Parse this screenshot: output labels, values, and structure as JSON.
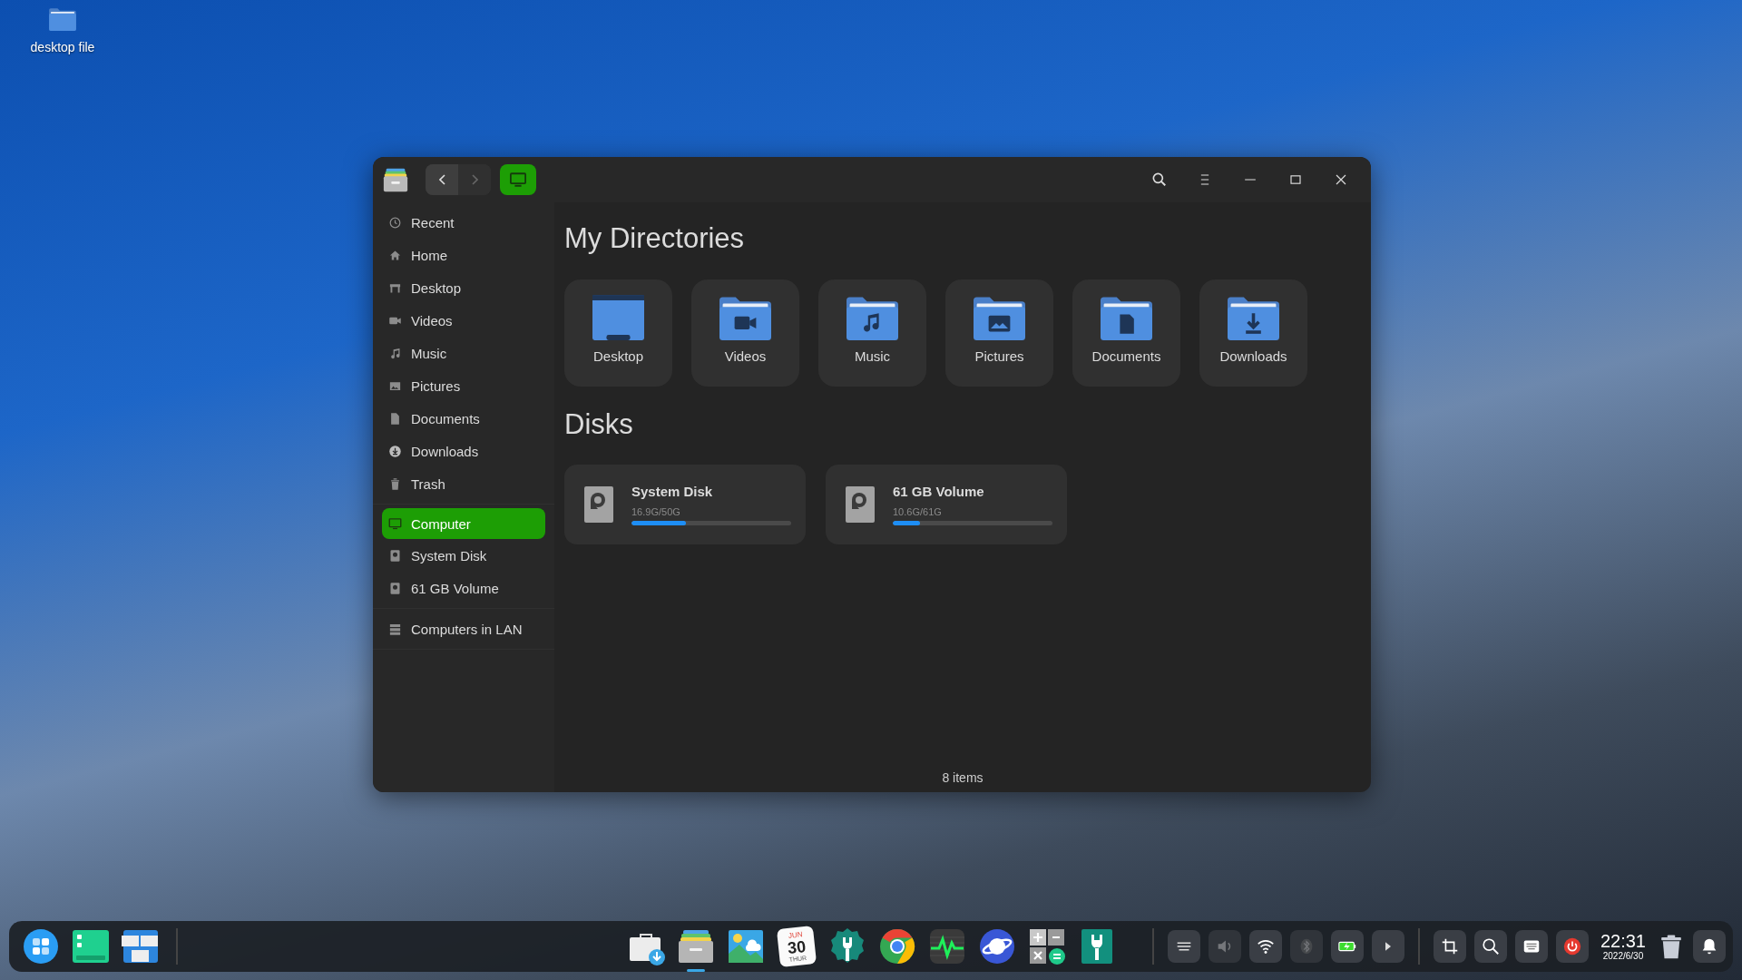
{
  "desktop_icons": [
    {
      "label": "desktop file"
    }
  ],
  "window": {
    "nav": [
      {
        "kind": "back",
        "disabled": false
      },
      {
        "kind": "forward",
        "disabled": true
      }
    ],
    "location_button": {
      "selected": true
    },
    "controls": [
      {
        "kind": "search"
      },
      {
        "kind": "menu"
      },
      {
        "kind": "minimize"
      },
      {
        "kind": "maximize"
      },
      {
        "kind": "close"
      }
    ],
    "sidebar": {
      "groups": [
        [
          {
            "kind": "recent",
            "label": "Recent",
            "selected": false
          },
          {
            "kind": "home",
            "label": "Home",
            "selected": false
          },
          {
            "kind": "desktop",
            "label": "Desktop",
            "selected": false
          },
          {
            "kind": "videos",
            "label": "Videos",
            "selected": false
          },
          {
            "kind": "music",
            "label": "Music",
            "selected": false
          },
          {
            "kind": "pictures",
            "label": "Pictures",
            "selected": false
          },
          {
            "kind": "documents",
            "label": "Documents",
            "selected": false
          },
          {
            "kind": "downloads",
            "label": "Downloads",
            "selected": false
          },
          {
            "kind": "trash",
            "label": "Trash",
            "selected": false
          }
        ],
        [
          {
            "kind": "computer",
            "label": "Computer",
            "selected": true
          },
          {
            "kind": "disk",
            "label": "System Disk",
            "selected": false
          },
          {
            "kind": "disk",
            "label": "61 GB Volume",
            "selected": false
          }
        ],
        [
          {
            "kind": "lan",
            "label": "Computers in LAN",
            "selected": false
          }
        ]
      ]
    },
    "directories": {
      "title": "My Directories",
      "items": [
        {
          "kind": "desktop",
          "label": "Desktop"
        },
        {
          "kind": "videos",
          "label": "Videos"
        },
        {
          "kind": "music",
          "label": "Music"
        },
        {
          "kind": "pictures",
          "label": "Pictures"
        },
        {
          "kind": "documents",
          "label": "Documents"
        },
        {
          "kind": "downloads",
          "label": "Downloads"
        }
      ]
    },
    "disks": {
      "title": "Disks",
      "items": [
        {
          "name": "System Disk",
          "usage": "16.9G/50G",
          "level": 0.34
        },
        {
          "name": "61 GB Volume",
          "usage": "10.6G/61G",
          "level": 0.17
        }
      ]
    },
    "status_bar": "8 items"
  },
  "taskbar": {
    "left": [
      {
        "kind": "launcher"
      },
      {
        "kind": "multitask"
      },
      {
        "kind": "workspaces"
      }
    ],
    "apps": [
      {
        "kind": "store",
        "running": false
      },
      {
        "kind": "files",
        "running": true
      },
      {
        "kind": "viewer",
        "running": false
      },
      {
        "kind": "calendar",
        "running": false,
        "month": "JUN",
        "day": "30",
        "weekday": "THUR"
      },
      {
        "kind": "settings",
        "running": false
      },
      {
        "kind": "chrome",
        "running": false
      },
      {
        "kind": "monitor",
        "running": false
      },
      {
        "kind": "browser",
        "running": false
      },
      {
        "kind": "calculator",
        "running": false
      },
      {
        "kind": "tools",
        "running": false
      }
    ],
    "tray": [
      {
        "kind": "keyboard-layout",
        "on": true
      },
      {
        "kind": "volume",
        "on": false
      },
      {
        "kind": "wifi",
        "on": true
      },
      {
        "kind": "bluetooth",
        "on": false
      },
      {
        "kind": "battery",
        "on": true
      },
      {
        "kind": "expand",
        "on": true
      }
    ],
    "actions": [
      {
        "kind": "screenshot"
      },
      {
        "kind": "search"
      },
      {
        "kind": "keyboard"
      },
      {
        "kind": "power"
      }
    ],
    "clock": {
      "time": "22:31",
      "date": "2022/6/30"
    },
    "end": [
      {
        "kind": "trash"
      },
      {
        "kind": "notifications"
      }
    ]
  }
}
